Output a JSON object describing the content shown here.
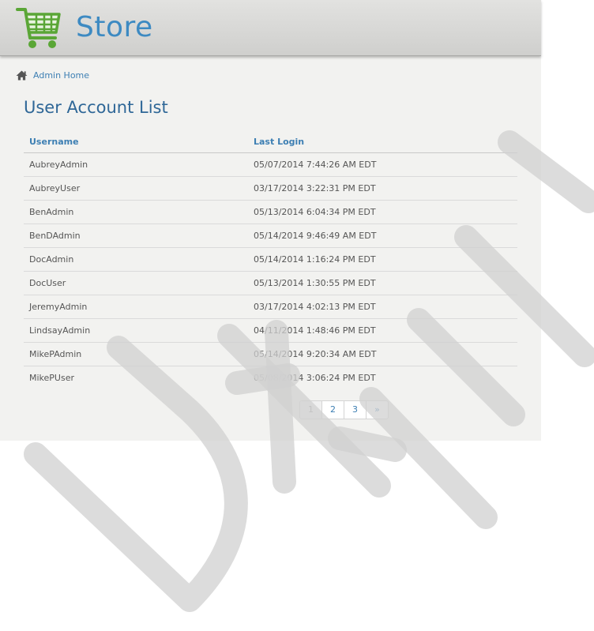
{
  "header": {
    "logo_text": "Store"
  },
  "breadcrumb": {
    "home_label": "Admin Home"
  },
  "page": {
    "title": "User Account List"
  },
  "table": {
    "columns": [
      "Username",
      "Last Login"
    ],
    "rows": [
      [
        "AubreyAdmin",
        "05/07/2014 7:44:26 AM EDT"
      ],
      [
        "AubreyUser",
        "03/17/2014 3:22:31 PM EDT"
      ],
      [
        "BenAdmin",
        "05/13/2014 6:04:34 PM EDT"
      ],
      [
        "BenDAdmin",
        "05/14/2014 9:46:49 AM EDT"
      ],
      [
        "DocAdmin",
        "05/14/2014 1:16:24 PM EDT"
      ],
      [
        "DocUser",
        "05/13/2014 1:30:55 PM EDT"
      ],
      [
        "JeremyAdmin",
        "03/17/2014 4:02:13 PM EDT"
      ],
      [
        "LindsayAdmin",
        "04/11/2014 1:48:46 PM EDT"
      ],
      [
        "MikePAdmin",
        "05/14/2014 9:20:34 AM EDT"
      ],
      [
        "MikePUser",
        "05/08/2014 3:06:24 PM EDT"
      ]
    ]
  },
  "pagination": {
    "pages": [
      "1",
      "2",
      "3"
    ],
    "current": "1",
    "next_label": "»"
  },
  "colors": {
    "brand": "#3d8ac2",
    "cart_green": "#5aa636",
    "link": "#3d7fb3"
  },
  "icons": {
    "logo": "shopping-cart-icon",
    "breadcrumb": "home-icon"
  }
}
